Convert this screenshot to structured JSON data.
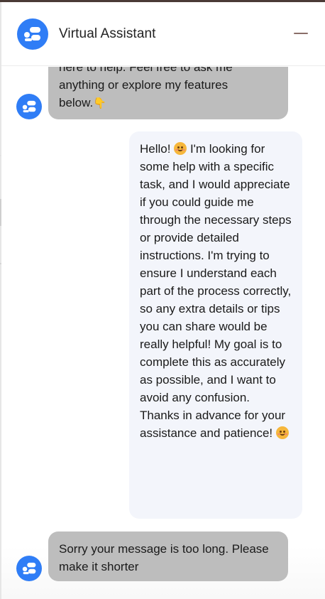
{
  "header": {
    "title": "Virtual Assistant",
    "avatar_icon": "assistant-logo-icon",
    "minimize_icon": "minimize-icon",
    "accent_color": "#2f7df6"
  },
  "messages": [
    {
      "sender": "bot",
      "text_lines": [
        "here to help. Feel free to ask me",
        "anything or explore my features"
      ],
      "last_line": "below.",
      "trailing_emoji": "pointing-down-hand-emoji"
    },
    {
      "sender": "user",
      "first_word": "Hello!",
      "body": "I'm looking for some help with a specific task, and I would appreciate if you could guide me through the necessary steps or provide detailed instructions. I'm trying to ensure I understand each part of the process correctly, so any extra details or tips you can share would be really helpful! My goal is to complete this as accurately as possible, and I want to avoid any confusion. Thanks in advance for your assistance and patience!",
      "emoji": "smiling-face-emoji"
    },
    {
      "sender": "bot",
      "text": "Sorry your message is too long. Please make it shorter"
    }
  ]
}
